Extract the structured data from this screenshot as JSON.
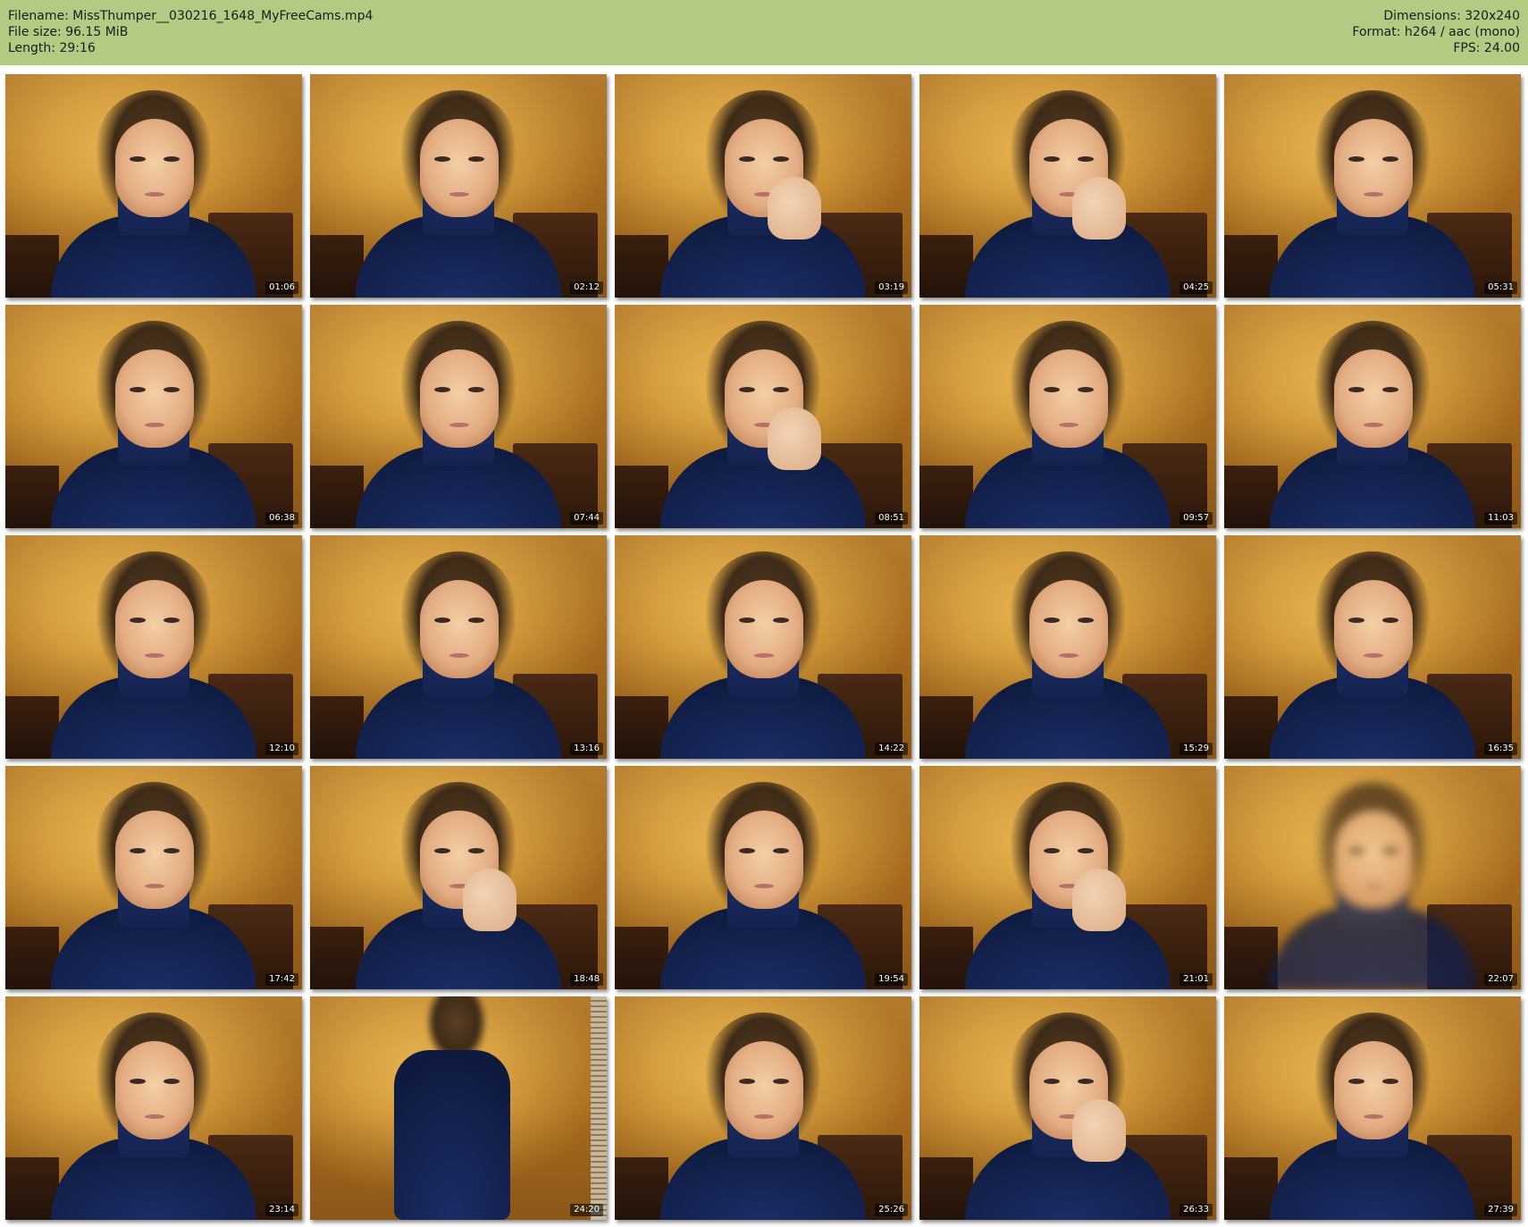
{
  "header": {
    "filename_line": "Filename: MissThumper__030216_1648_MyFreeCams.mp4",
    "filesize_line": "File size: 96.15 MiB",
    "length_line": "Length: 29:16",
    "dimensions_line": "Dimensions: 320x240",
    "format_line": "Format: h264 / aac (mono)",
    "fps_line": "FPS: 24.00"
  },
  "colors": {
    "header_bg": "#b1cc82",
    "page_bg": "#ffffff",
    "timestamp_bg": "#000000",
    "timestamp_fg": "#ffffff"
  },
  "thumbnails": [
    {
      "time": "01:06"
    },
    {
      "time": "02:12"
    },
    {
      "time": "03:19"
    },
    {
      "time": "04:25"
    },
    {
      "time": "05:31"
    },
    {
      "time": "06:38"
    },
    {
      "time": "07:44"
    },
    {
      "time": "08:51"
    },
    {
      "time": "09:57"
    },
    {
      "time": "11:03"
    },
    {
      "time": "12:10"
    },
    {
      "time": "13:16"
    },
    {
      "time": "14:22"
    },
    {
      "time": "15:29"
    },
    {
      "time": "16:35"
    },
    {
      "time": "17:42"
    },
    {
      "time": "18:48"
    },
    {
      "time": "19:54"
    },
    {
      "time": "21:01"
    },
    {
      "time": "22:07"
    },
    {
      "time": "23:14"
    },
    {
      "time": "24:20"
    },
    {
      "time": "25:26"
    },
    {
      "time": "26:33"
    },
    {
      "time": "27:39"
    }
  ]
}
